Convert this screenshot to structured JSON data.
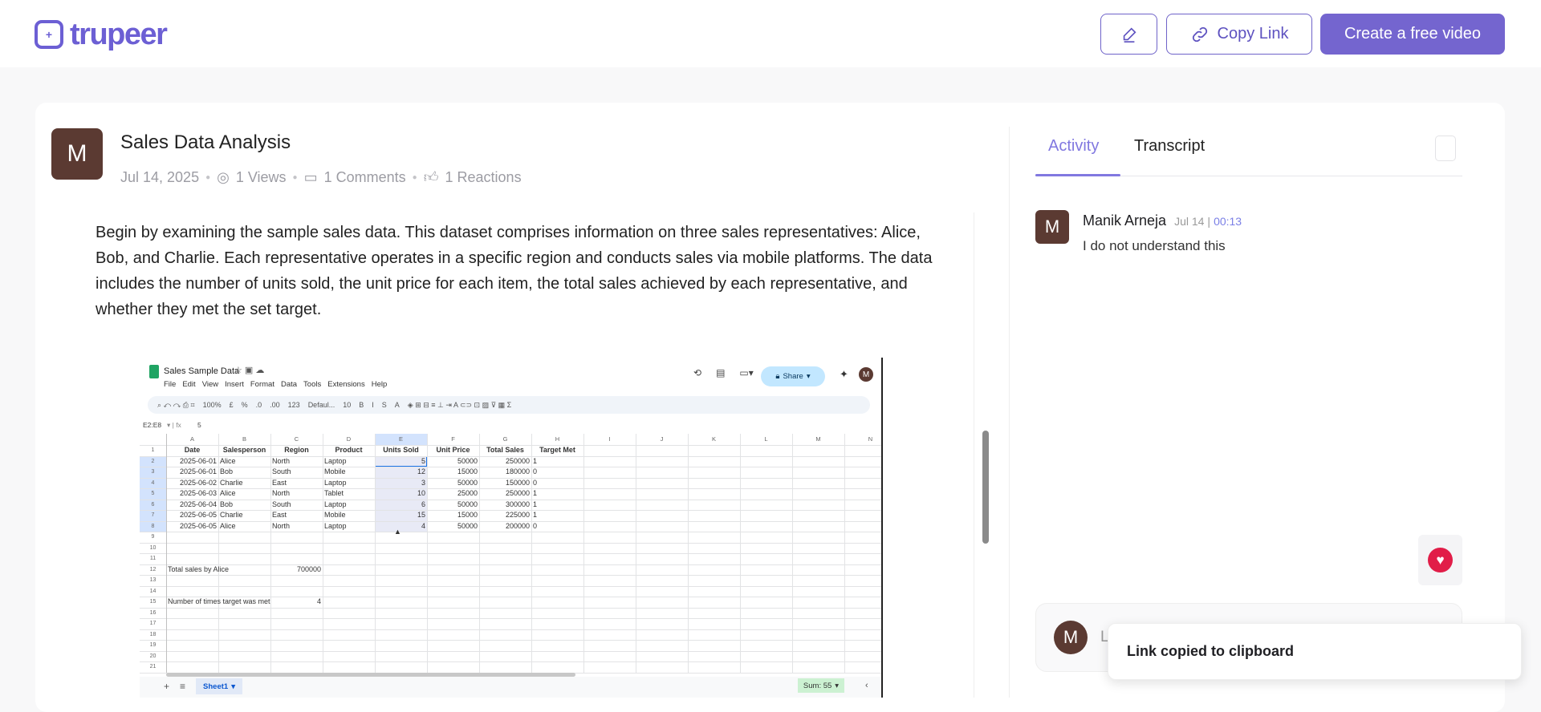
{
  "header": {
    "logo_text": "trupeer",
    "copy_link": "Copy Link",
    "create_video": "Create a free video"
  },
  "post": {
    "avatar_initial": "M",
    "title": "Sales Data Analysis",
    "date": "Jul 14, 2025",
    "views": "1 Views",
    "comments": "1 Comments",
    "reactions": "1 Reactions",
    "paragraph": "Begin by examining the sample sales data. This dataset comprises information on three sales representatives: Alice, Bob, and Charlie. Each representative operates in a specific region and conducts sales via mobile platforms. The data includes the number of units sold, the unit price for each item, the total sales achieved by each representative, and whether they met the set target."
  },
  "sheet": {
    "title": "Sales Sample Data",
    "menu": [
      "File",
      "Edit",
      "View",
      "Insert",
      "Format",
      "Data",
      "Tools",
      "Extensions",
      "Help"
    ],
    "toolbar": [
      "100%",
      "£",
      "%",
      ".0",
      ".00",
      "123",
      "Defaul...",
      "10",
      "B",
      "I",
      "S",
      "A"
    ],
    "share": "Share",
    "avatar": "M",
    "cell_ref": "E2:E8",
    "formula": "5",
    "columns": [
      "A",
      "B",
      "C",
      "D",
      "E",
      "F",
      "G",
      "H",
      "I",
      "J",
      "K",
      "L",
      "M",
      "N"
    ],
    "rows": [
      [
        "Date",
        "Salesperson",
        "Region",
        "Product",
        "Units Sold",
        "Unit Price",
        "Total Sales",
        "Target Met"
      ],
      [
        "2025-06-01",
        "Alice",
        "North",
        "Laptop",
        "5",
        "50000",
        "250000",
        "1"
      ],
      [
        "2025-06-01",
        "Bob",
        "South",
        "Mobile",
        "12",
        "15000",
        "180000",
        "0"
      ],
      [
        "2025-06-02",
        "Charlie",
        "East",
        "Laptop",
        "3",
        "50000",
        "150000",
        "0"
      ],
      [
        "2025-06-03",
        "Alice",
        "North",
        "Tablet",
        "10",
        "25000",
        "250000",
        "1"
      ],
      [
        "2025-06-04",
        "Bob",
        "South",
        "Laptop",
        "6",
        "50000",
        "300000",
        "1"
      ],
      [
        "2025-06-05",
        "Charlie",
        "East",
        "Mobile",
        "15",
        "15000",
        "225000",
        "1"
      ],
      [
        "2025-06-05",
        "Alice",
        "North",
        "Laptop",
        "4",
        "50000",
        "200000",
        "0"
      ]
    ],
    "summary": [
      {
        "row": 12,
        "label": "Total sales by Alice",
        "value": "700000"
      },
      {
        "row": 15,
        "label": "Number of times target was met",
        "value": "4"
      }
    ],
    "row_count": 21,
    "tab": "Sheet1",
    "sum": "Sum: 55"
  },
  "panel": {
    "tabs": [
      "Activity",
      "Transcript"
    ],
    "comment": {
      "initial": "M",
      "author": "Manik Arneja",
      "date": "Jul 14",
      "time": "00:13",
      "text": "I do not understand this"
    },
    "input_initial": "M",
    "input_placeholder": "L"
  },
  "toast": "Link copied to clipboard",
  "colors": {
    "accent": "#7465cf",
    "avatar": "#5b3a32",
    "heart": "#e11d48"
  }
}
